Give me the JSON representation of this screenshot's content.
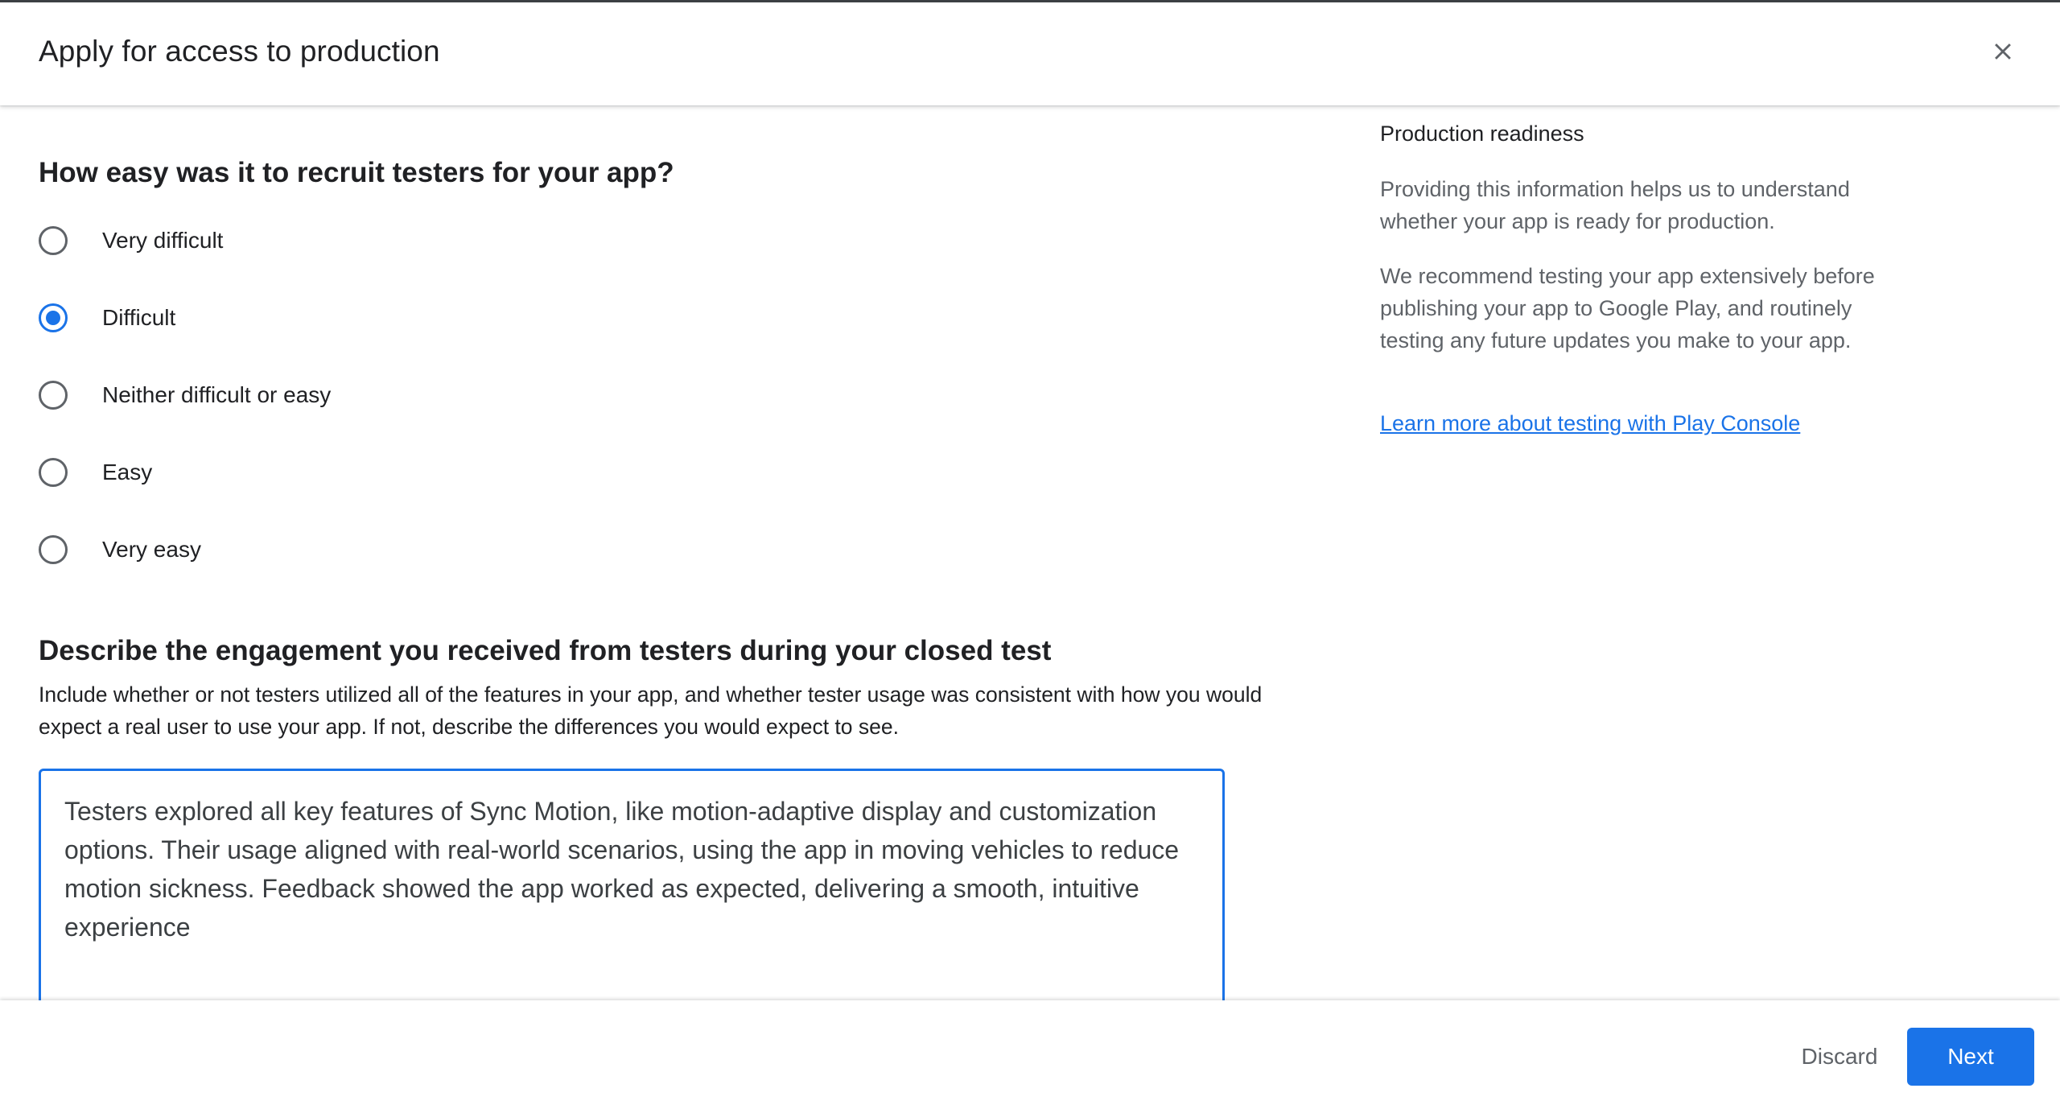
{
  "dialog": {
    "title": "Apply for access to production"
  },
  "question1": {
    "title": "How easy was it to recruit testers for your app?",
    "options": [
      {
        "label": "Very difficult",
        "selected": false
      },
      {
        "label": "Difficult",
        "selected": true
      },
      {
        "label": "Neither difficult or easy",
        "selected": false
      },
      {
        "label": "Easy",
        "selected": false
      },
      {
        "label": "Very easy",
        "selected": false
      }
    ]
  },
  "question2": {
    "title": "Describe the engagement you received from testers during your closed test",
    "description": "Include whether or not testers utilized all of the features in your app, and whether tester usage was consistent with how you would expect a real user to use your app. If not, describe the differences you would expect to see.",
    "answer": "Testers explored all key features of Sync Motion, like motion-adaptive display and customization options. Their usage aligned with real-world scenarios, using the app in moving vehicles to reduce motion sickness. Feedback showed the app worked as expected, delivering a smooth, intuitive experience"
  },
  "sidebar": {
    "title": "Production readiness",
    "paragraph1": "Providing this information helps us to understand whether your app is ready for production.",
    "paragraph2": "We recommend testing your app extensively before publishing your app to Google Play, and routinely testing any future updates you make to your app.",
    "link": "Learn more about testing with Play Console"
  },
  "footer": {
    "discard_label": "Discard",
    "next_label": "Next"
  },
  "colors": {
    "accent": "#1a73e8",
    "text": "#202124",
    "secondary_text": "#5f6368"
  },
  "icons": {
    "close": "close-icon"
  }
}
